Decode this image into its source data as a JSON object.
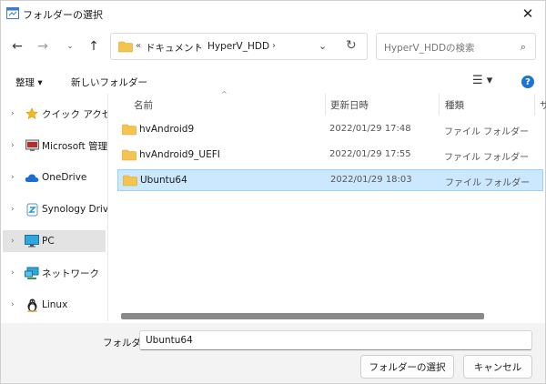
{
  "window": {
    "title": "フォルダーの選択",
    "close_icon": "close-icon"
  },
  "address": {
    "overflow": "«",
    "crumbs": [
      "ドキュメント",
      "HyperV_HDD"
    ],
    "separator": "›"
  },
  "search": {
    "placeholder": "HyperV_HDDの検索"
  },
  "toolbar": {
    "organize_label": "整理",
    "new_folder_label": "新しいフォルダー",
    "help": "?"
  },
  "sidebar": {
    "items": [
      {
        "label": "クイック アクセス",
        "icon": "star-icon"
      },
      {
        "label": "Microsoft 管理コンソール",
        "icon": "mmc-icon"
      },
      {
        "label": "OneDrive",
        "icon": "cloud-icon"
      },
      {
        "label": "Synology Drive",
        "icon": "synology-icon"
      },
      {
        "label": "PC",
        "icon": "monitor-icon",
        "selected": true
      },
      {
        "label": "ネットワーク",
        "icon": "network-icon"
      },
      {
        "label": "Linux",
        "icon": "linux-icon"
      }
    ]
  },
  "list": {
    "columns": [
      "名前",
      "更新日時",
      "種類",
      "サ"
    ],
    "rows": [
      {
        "name": "hvAndroid9",
        "date": "2022/01/29 17:48",
        "type": "ファイル フォルダー"
      },
      {
        "name": "hvAndroid9_UEFI",
        "date": "2022/01/29 17:55",
        "type": "ファイル フォルダー"
      },
      {
        "name": "Ubuntu64",
        "date": "2022/01/29 18:03",
        "type": "ファイル フォルダー",
        "selected": true
      }
    ]
  },
  "footer": {
    "folder_label": "フォルダー:",
    "folder_value": "Ubuntu64",
    "select_button": "フォルダーの選択",
    "cancel_button": "キャンセル"
  },
  "colors": {
    "accent": "#1a74d3",
    "selection": "#cce8ff",
    "folder": "#f4c44f"
  }
}
